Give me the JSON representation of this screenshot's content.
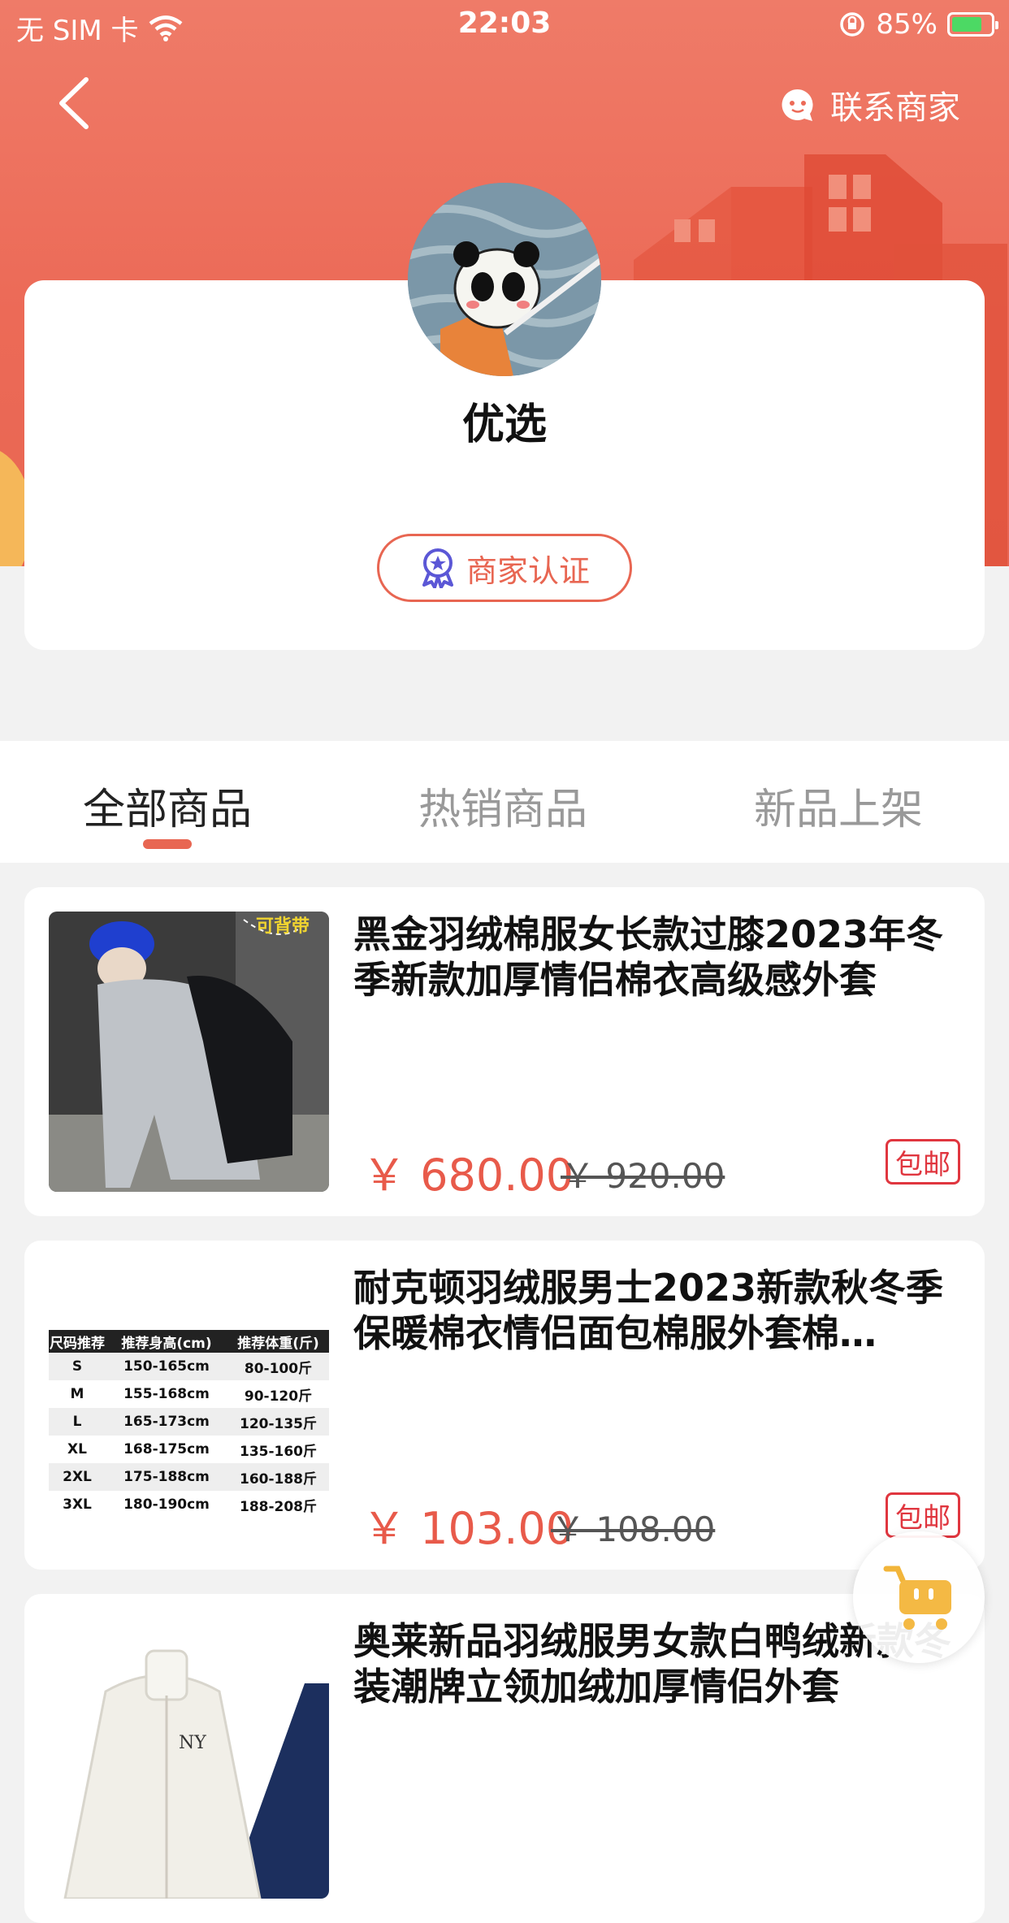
{
  "status_bar": {
    "carrier": "无 SIM 卡",
    "time": "22:03",
    "battery": "85%",
    "battery_level": 0.85
  },
  "header": {
    "contact_label": "联系商家"
  },
  "shop": {
    "name": "优选",
    "cert_label": "商家认证"
  },
  "tabs": [
    {
      "label": "全部商品",
      "active": true
    },
    {
      "label": "热销商品",
      "active": false
    },
    {
      "label": "新品上架",
      "active": false
    }
  ],
  "products": [
    {
      "title": "黑金羽绒棉服女长款过膝2023年冬季新款加厚情侣棉衣高级感外套",
      "price": "￥ 680.00",
      "original_price": "￥ 920.00",
      "tag": "包邮",
      "image_overlay_text": "可背带"
    },
    {
      "title": "耐克顿羽绒服男士2023新款秋冬季保暖棉衣情侣面包棉服外套棉…",
      "price": "￥ 103.00",
      "original_price": "￥ 108.00",
      "tag": "包邮",
      "size_table": {
        "headers": [
          "尺码推荐",
          "推荐身高(cm)",
          "推荐体重(斤)"
        ],
        "rows": [
          [
            "S",
            "150-165cm",
            "80-100斤"
          ],
          [
            "M",
            "155-168cm",
            "90-120斤"
          ],
          [
            "L",
            "165-173cm",
            "120-135斤"
          ],
          [
            "XL",
            "168-175cm",
            "135-160斤"
          ],
          [
            "2XL",
            "175-188cm",
            "160-188斤"
          ],
          [
            "3XL",
            "180-190cm",
            "188-208斤"
          ]
        ]
      }
    },
    {
      "title": "奥莱新品羽绒服男女款白鸭绒新款冬装潮牌立领加绒加厚情侣外套",
      "price": "",
      "original_price": "",
      "tag": ""
    }
  ],
  "icons": {
    "back": "chevron-left-icon",
    "contact": "chat-icon",
    "cert": "badge-icon",
    "cart": "cart-icon"
  },
  "colors": {
    "accent": "#e86652",
    "price": "#e85a4a",
    "tag": "#e0363f",
    "hero": "#ec6a57"
  }
}
